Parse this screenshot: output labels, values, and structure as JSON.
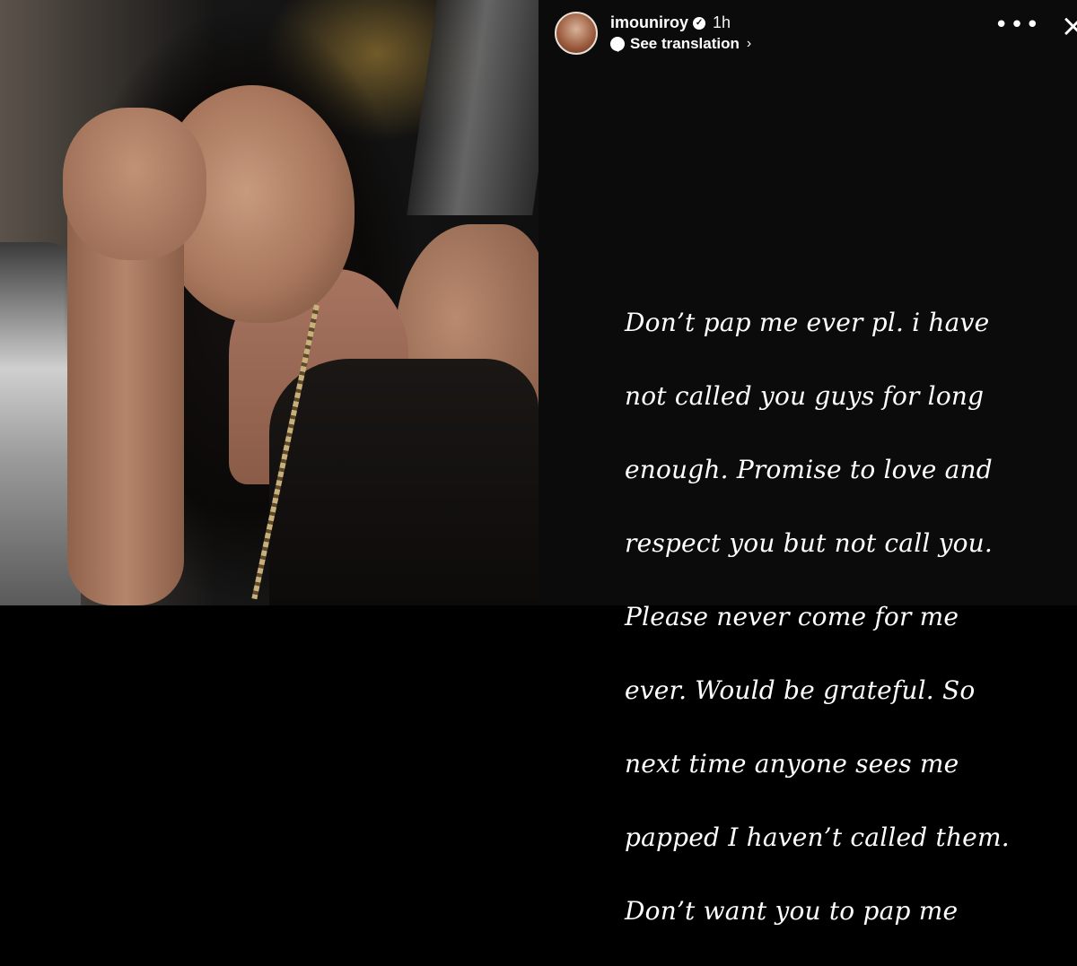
{
  "story": {
    "username": "imouniroy",
    "time_ago": "1h",
    "see_translation": "See translation",
    "chevron": "›",
    "more": "•••",
    "close": "×",
    "message_lines": [
      "Don’t pap me ever pl. i have",
      "not called you guys for long",
      "enough. Promise to love and",
      "respect you but not call you.",
      "Please never come for me",
      "ever. Would be grateful. So",
      "next time anyone sees me",
      "papped I haven’t called them.",
      "Don’t want you to pap me"
    ]
  },
  "colors": {
    "story_background": "#0b0b0b",
    "text": "#ffffff"
  },
  "icons": {
    "verified": "verified-badge-icon",
    "translate": "translate-bubble-icon",
    "more": "more-dots-icon",
    "close": "close-icon"
  }
}
